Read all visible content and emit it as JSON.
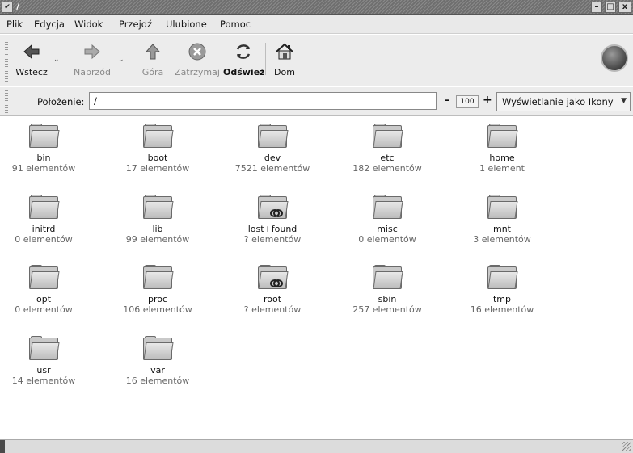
{
  "window": {
    "title": "/",
    "menu_glyph": "✔",
    "minimize_glyph": "–",
    "maximize_glyph": "□",
    "close_glyph": "x"
  },
  "menubar": {
    "items": [
      "Plik",
      "Edycja",
      "Widok",
      "Przejdź",
      "Ulubione",
      "Pomoc"
    ]
  },
  "toolbar": {
    "back": "Wstecz",
    "forward": "Naprzód",
    "up": "Góra",
    "stop": "Zatrzymaj",
    "reload": "Odśwież",
    "home": "Dom"
  },
  "location": {
    "label": "Położenie:",
    "value": "/",
    "zoom_minus": "–",
    "zoom_level": "100",
    "zoom_plus": "+",
    "view_mode": "Wyświetlanie jako Ikony"
  },
  "folders": [
    {
      "name": "bin",
      "count": "91 elementów",
      "locked": false
    },
    {
      "name": "boot",
      "count": "17 elementów",
      "locked": false
    },
    {
      "name": "dev",
      "count": "7521 elementów",
      "locked": false
    },
    {
      "name": "etc",
      "count": "182 elementów",
      "locked": false
    },
    {
      "name": "home",
      "count": "1 element",
      "locked": false
    },
    {
      "name": "initrd",
      "count": "0 elementów",
      "locked": false
    },
    {
      "name": "lib",
      "count": "99 elementów",
      "locked": false
    },
    {
      "name": "lost+found",
      "count": "? elementów",
      "locked": true
    },
    {
      "name": "misc",
      "count": "0 elementów",
      "locked": false
    },
    {
      "name": "mnt",
      "count": "3 elementów",
      "locked": false
    },
    {
      "name": "opt",
      "count": "0 elementów",
      "locked": false
    },
    {
      "name": "proc",
      "count": "106 elementów",
      "locked": false
    },
    {
      "name": "root",
      "count": "? elementów",
      "locked": true
    },
    {
      "name": "sbin",
      "count": "257 elementów",
      "locked": false
    },
    {
      "name": "tmp",
      "count": "16 elementów",
      "locked": false
    },
    {
      "name": "usr",
      "count": "14 elementów",
      "locked": false
    },
    {
      "name": "var",
      "count": "16 elementów",
      "locked": false
    }
  ]
}
